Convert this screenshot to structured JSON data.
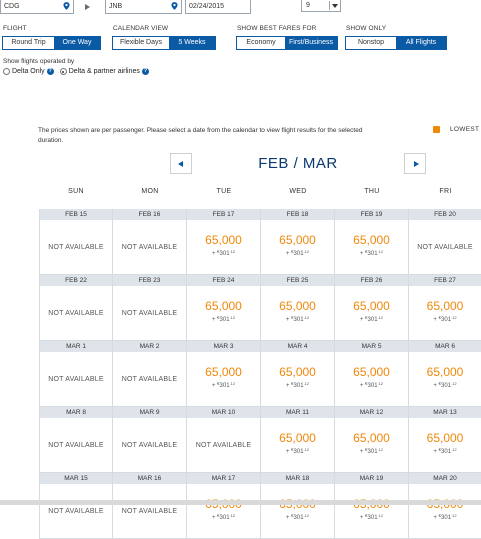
{
  "search": {
    "origin": "CDG",
    "destination": "JNB",
    "date": "02/24/2015",
    "passengers": "9"
  },
  "filters": {
    "flight": {
      "label": "FLIGHT",
      "options": [
        "Round Trip",
        "One Way"
      ],
      "selected": "One Way"
    },
    "calendar_view": {
      "label": "CALENDAR VIEW",
      "options": [
        "Flexible Days",
        "5 Weeks"
      ],
      "selected": "5 Weeks"
    },
    "best_fares": {
      "label": "SHOW BEST FARES FOR",
      "options": [
        "Economy",
        "First/Business"
      ],
      "selected": "First/Business"
    },
    "show_only": {
      "label": "SHOW ONLY",
      "options": [
        "Nonstop",
        "All Flights"
      ],
      "selected": "All Flights"
    }
  },
  "operated_by": {
    "label": "Show flights operated by",
    "options": [
      "Delta Only",
      "Delta & partner airlines"
    ],
    "selected": "Delta & partner airlines"
  },
  "calendar": {
    "note": "The prices shown are per passenger. Please select a date from the calendar to view flight results for the selected duration.",
    "legend_lowest": "LOWEST",
    "legend_color": "#f0880a",
    "month": "FEB / MAR",
    "weekdays": [
      "SUN",
      "MON",
      "TUE",
      "WED",
      "THU",
      "FRI"
    ],
    "weeks": [
      [
        {
          "date": "FEB 15",
          "status": "NOT AVAILABLE"
        },
        {
          "date": "FEB 16",
          "status": "NOT AVAILABLE"
        },
        {
          "date": "FEB 17",
          "miles": "65,000",
          "tax_prefix": "+ ",
          "currency": "€",
          "tax": "301",
          "cents": ".12"
        },
        {
          "date": "FEB 18",
          "miles": "65,000",
          "tax_prefix": "+ ",
          "currency": "€",
          "tax": "301",
          "cents": ".12"
        },
        {
          "date": "FEB 19",
          "miles": "65,000",
          "tax_prefix": "+ ",
          "currency": "€",
          "tax": "301",
          "cents": ".12"
        },
        {
          "date": "FEB 20",
          "status": "NOT AVAILABLE"
        }
      ],
      [
        {
          "date": "FEB 22",
          "status": "NOT AVAILABLE"
        },
        {
          "date": "FEB 23",
          "status": "NOT AVAILABLE"
        },
        {
          "date": "FEB 24",
          "miles": "65,000",
          "tax_prefix": "+ ",
          "currency": "€",
          "tax": "301",
          "cents": ".12"
        },
        {
          "date": "FEB 25",
          "miles": "65,000",
          "tax_prefix": "+ ",
          "currency": "€",
          "tax": "301",
          "cents": ".12"
        },
        {
          "date": "FEB 26",
          "miles": "65,000",
          "tax_prefix": "+ ",
          "currency": "€",
          "tax": "301",
          "cents": ".12"
        },
        {
          "date": "FEB 27",
          "miles": "65,000",
          "tax_prefix": "+ ",
          "currency": "€",
          "tax": "301",
          "cents": ".12"
        }
      ],
      [
        {
          "date": "MAR 1",
          "status": "NOT AVAILABLE"
        },
        {
          "date": "MAR 2",
          "status": "NOT AVAILABLE"
        },
        {
          "date": "MAR 3",
          "miles": "65,000",
          "tax_prefix": "+ ",
          "currency": "€",
          "tax": "301",
          "cents": ".12"
        },
        {
          "date": "MAR 4",
          "miles": "65,000",
          "tax_prefix": "+ ",
          "currency": "€",
          "tax": "301",
          "cents": ".12"
        },
        {
          "date": "MAR 5",
          "miles": "65,000",
          "tax_prefix": "+ ",
          "currency": "€",
          "tax": "301",
          "cents": ".12"
        },
        {
          "date": "MAR 6",
          "miles": "65,000",
          "tax_prefix": "+ ",
          "currency": "€",
          "tax": "301",
          "cents": ".12"
        }
      ],
      [
        {
          "date": "MAR 8",
          "status": "NOT AVAILABLE"
        },
        {
          "date": "MAR 9",
          "status": "NOT AVAILABLE"
        },
        {
          "date": "MAR 10",
          "status": "NOT AVAILABLE"
        },
        {
          "date": "MAR 11",
          "miles": "65,000",
          "tax_prefix": "+ ",
          "currency": "€",
          "tax": "301",
          "cents": ".12"
        },
        {
          "date": "MAR 12",
          "miles": "65,000",
          "tax_prefix": "+ ",
          "currency": "€",
          "tax": "301",
          "cents": ".12"
        },
        {
          "date": "MAR 13",
          "miles": "65,000",
          "tax_prefix": "+ ",
          "currency": "€",
          "tax": "301",
          "cents": ".12"
        }
      ],
      [
        {
          "date": "MAR 15",
          "status": "NOT AVAILABLE"
        },
        {
          "date": "MAR 16",
          "status": "NOT AVAILABLE"
        },
        {
          "date": "MAR 17",
          "miles": "65,000",
          "tax_prefix": "+ ",
          "currency": "€",
          "tax": "301",
          "cents": ".12"
        },
        {
          "date": "MAR 18",
          "miles": "65,000",
          "tax_prefix": "+ ",
          "currency": "€",
          "tax": "301",
          "cents": ".12"
        },
        {
          "date": "MAR 19",
          "miles": "65,000",
          "tax_prefix": "+ ",
          "currency": "€",
          "tax": "301",
          "cents": ".12"
        },
        {
          "date": "MAR 20",
          "miles": "65,000",
          "tax_prefix": "+ ",
          "currency": "€",
          "tax": "301",
          "cents": ".12"
        }
      ]
    ]
  }
}
